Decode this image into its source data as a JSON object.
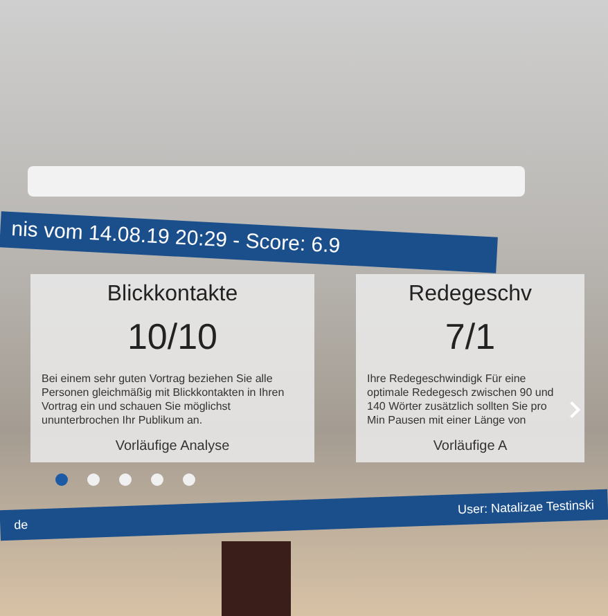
{
  "header": {
    "title": "nis vom 14.08.19 20:29 - Score: 6.9"
  },
  "cards": [
    {
      "title": "Blickkontakte",
      "score": "10/10",
      "text": "Bei einem sehr guten Vortrag beziehen Sie alle Personen gleichmäßig mit Blickkontakten in Ihren Vortrag ein und schauen Sie möglichst ununterbrochen Ihr Publikum an.",
      "link": "Vorläufige Analyse"
    },
    {
      "title": "Redegeschv",
      "score": "7/1",
      "text": "Ihre Redegeschwindigk Für eine optimale Redegesch zwischen 90 und 140 Wörter zusätzlich sollten Sie pro Min Pausen mit einer Länge von",
      "link": "Vorläufige A"
    }
  ],
  "pager": [
    {
      "selected": true
    },
    {
      "selected": false
    },
    {
      "selected": false
    },
    {
      "selected": false
    },
    {
      "selected": false
    }
  ],
  "footer": {
    "left": "de",
    "user": "User: Natalizae Testinski"
  }
}
